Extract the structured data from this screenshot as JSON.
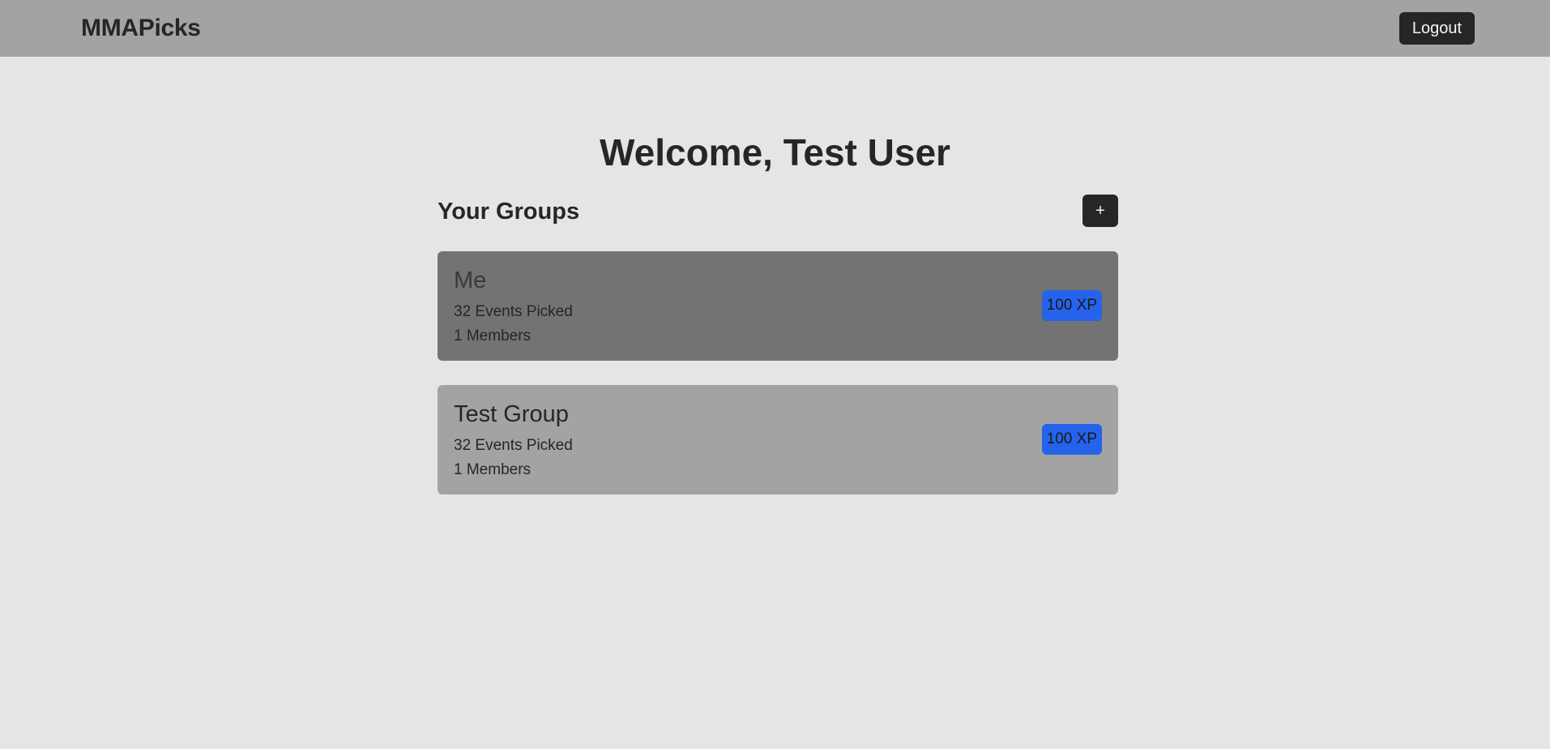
{
  "navbar": {
    "brand": "MMAPicks",
    "logout_label": "Logout"
  },
  "main": {
    "welcome": "Welcome, Test User",
    "groups_title": "Your Groups",
    "add_label": "+"
  },
  "groups": [
    {
      "name": "Me",
      "events": "32 Events Picked",
      "members": "1 Members",
      "xp": "100 XP",
      "selected": true
    },
    {
      "name": "Test Group",
      "events": "32 Events Picked",
      "members": "1 Members",
      "xp": "100 XP",
      "selected": false
    }
  ],
  "colors": {
    "background": "#e5e5e5",
    "navbar": "#a3a3a3",
    "button": "#262626",
    "card_selected": "#737373",
    "card": "#a3a3a3",
    "xp_badge": "#2563eb"
  }
}
